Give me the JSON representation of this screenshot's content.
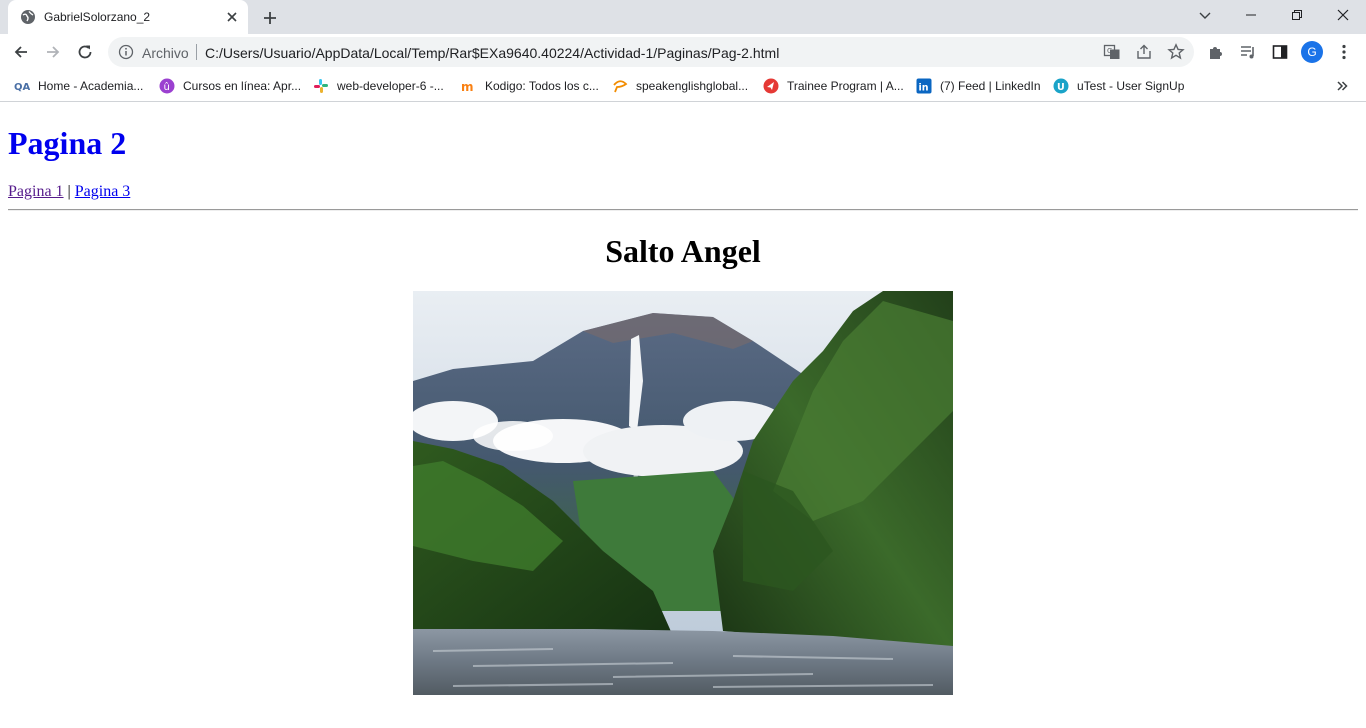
{
  "browser": {
    "tab": {
      "title": "GabrielSolorzano_2"
    },
    "omnibox": {
      "scheme_label": "Archivo",
      "url": "C:/Users/Usuario/AppData/Local/Temp/Rar$EXa9640.40224/Actividad-1/Paginas/Pag-2.html"
    },
    "profile_initial": "G",
    "bookmarks": [
      {
        "label": "Home - Academia...",
        "icon": "qa-icon",
        "color": "#4a6fa5"
      },
      {
        "label": "Cursos en línea: Apr...",
        "icon": "platzi-icon",
        "color": "#9b40d0"
      },
      {
        "label": "web-developer-6 -...",
        "icon": "slack-icon",
        "color": "#e01e5a"
      },
      {
        "label": "Kodigo: Todos los c...",
        "icon": "moodle-icon",
        "color": "#f98012"
      },
      {
        "label": "speakenglishglobal...",
        "icon": "speak-icon",
        "color": "#f28c00"
      },
      {
        "label": "Trainee Program | A...",
        "icon": "trainee-icon",
        "color": "#e53935"
      },
      {
        "label": "(7) Feed | LinkedIn",
        "icon": "linkedin-icon",
        "color": "#0a66c2"
      },
      {
        "label": "uTest - User SignUp",
        "icon": "utest-icon",
        "color": "#1aa3c8"
      }
    ]
  },
  "page": {
    "heading": "Pagina 2",
    "links": [
      {
        "label": "Pagina 1"
      },
      {
        "label": "Pagina 3"
      }
    ],
    "separator": "|",
    "section_title": "Salto Angel"
  },
  "colors": {
    "heading": "#0000ee",
    "link": "#0000ee",
    "visited_link": "#551a8b"
  }
}
